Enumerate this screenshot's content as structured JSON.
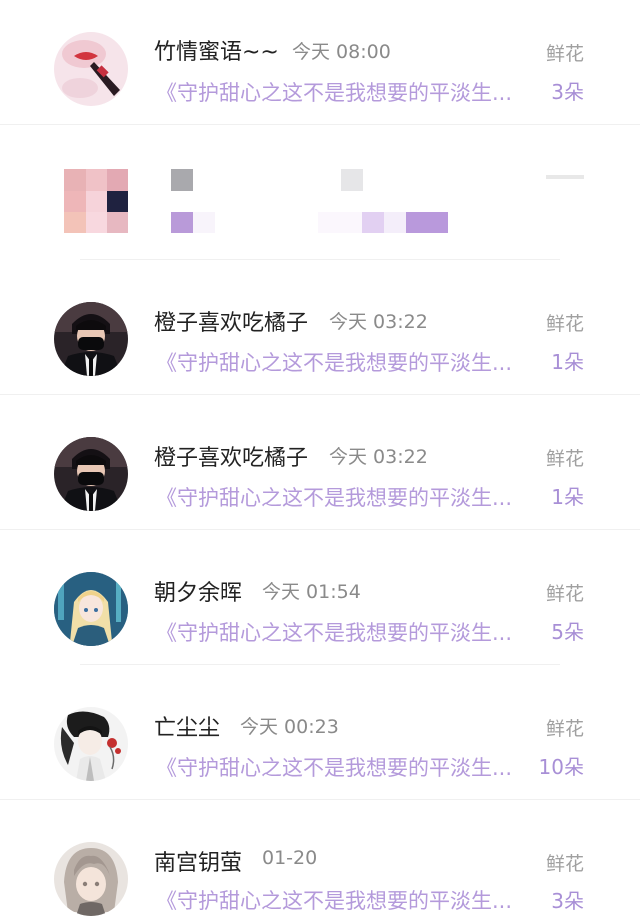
{
  "gift_list": {
    "items": [
      {
        "name": "竹情蜜语~~",
        "time": "今天 08:00",
        "book": "《守护甜心之这不是我想要的平淡生...",
        "gift_label": "鲜花",
        "gift_count": "3朵",
        "avatar_icon": "avatar-lips-photo"
      },
      {
        "name": "橙子喜欢吃橘子",
        "time": "今天 03:22",
        "book": "《守护甜心之这不是我想要的平淡生...",
        "gift_label": "鲜花",
        "gift_count": "1朵",
        "avatar_icon": "avatar-masked-boy"
      },
      {
        "name": "橙子喜欢吃橘子",
        "time": "今天 03:22",
        "book": "《守护甜心之这不是我想要的平淡生...",
        "gift_label": "鲜花",
        "gift_count": "1朵",
        "avatar_icon": "avatar-masked-boy"
      },
      {
        "name": "朝夕余晖",
        "time": "今天 01:54",
        "book": "《守护甜心之这不是我想要的平淡生...",
        "gift_label": "鲜花",
        "gift_count": "5朵",
        "avatar_icon": "avatar-anime-girl-blue"
      },
      {
        "name": "亡尘尘",
        "time": "今天 00:23",
        "book": "《守护甜心之这不是我想要的平淡生...",
        "gift_label": "鲜花",
        "gift_count": "10朵",
        "avatar_icon": "avatar-ink-character"
      },
      {
        "name": "南宫钥萤",
        "time": "01-20",
        "book": "《守护甜心之这不是我想要的平淡生...",
        "gift_label": "鲜花",
        "gift_count": "3朵",
        "avatar_icon": "avatar-anime-silver-hair"
      }
    ],
    "censored_row": {
      "avatar_icon": "pixelated-avatar-icon"
    }
  },
  "colors": {
    "name": "#222222",
    "time": "#8a8a8a",
    "book": "#b49adb",
    "gift_label": "#a0a0a0",
    "gift_count": "#a88fd6",
    "divider": "#f0f0f0"
  }
}
